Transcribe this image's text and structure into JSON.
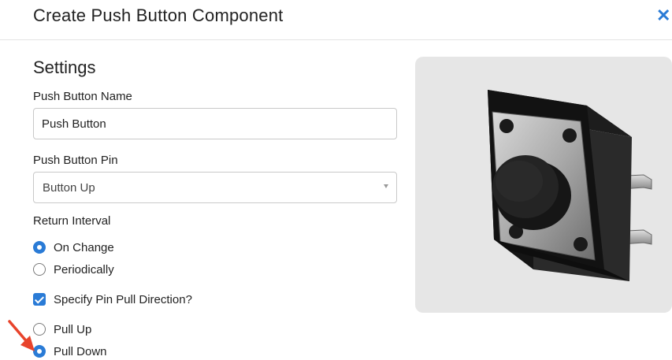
{
  "dialog": {
    "title": "Create Push Button Component",
    "close_icon": "close-icon"
  },
  "settings": {
    "heading": "Settings",
    "name_label": "Push Button Name",
    "name_value": "Push Button",
    "pin_label": "Push Button Pin",
    "pin_selected": "Button Up",
    "interval_label": "Return Interval",
    "interval_options": [
      {
        "label": "On Change",
        "checked": true
      },
      {
        "label": "Periodically",
        "checked": false
      }
    ],
    "pull_checkbox_label": "Specify Pin Pull Direction?",
    "pull_checkbox_checked": true,
    "pull_options": [
      {
        "label": "Pull Up",
        "checked": false
      },
      {
        "label": "Pull Down",
        "checked": true
      }
    ]
  },
  "preview": {
    "image": "push-button-illustration"
  },
  "colors": {
    "accent": "#2a7bd6",
    "annotation_arrow": "#e8432b",
    "panel_bg": "#e6e6e6"
  }
}
